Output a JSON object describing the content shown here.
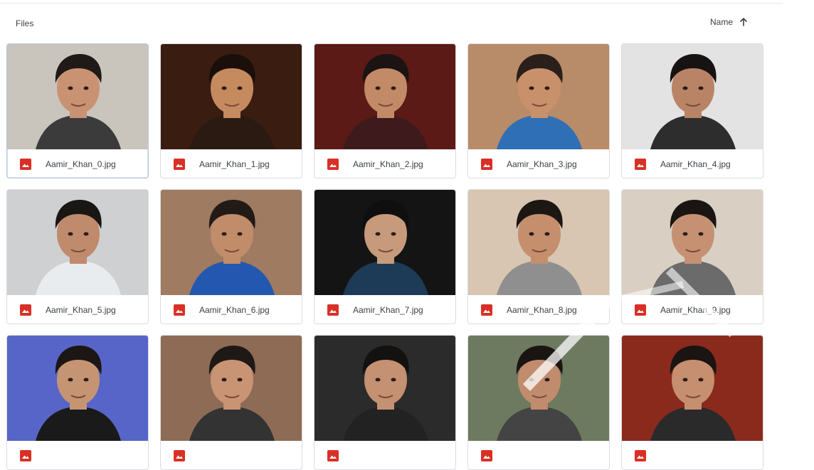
{
  "header": {
    "section_title": "Files",
    "sort_label": "Name",
    "sort_icon": "arrow-up-icon"
  },
  "files": [
    {
      "name": "Aamir_Khan_0.jpg",
      "bg": "#c9c4bc",
      "skin": "#c99273",
      "hair": "#1f1a17",
      "shirt": "#3b3b3b"
    },
    {
      "name": "Aamir_Khan_1.jpg",
      "bg": "#3a1c10",
      "skin": "#c58a5e",
      "hair": "#1a0f0a",
      "shirt": "#2a1a12"
    },
    {
      "name": "Aamir_Khan_2.jpg",
      "bg": "#5b1a16",
      "skin": "#c28a66",
      "hair": "#1b1412",
      "shirt": "#3f1a1c"
    },
    {
      "name": "Aamir_Khan_3.jpg",
      "bg": "#b88b69",
      "skin": "#c8906b",
      "hair": "#2a1f1a",
      "shirt": "#2f6fb5"
    },
    {
      "name": "Aamir_Khan_4.jpg",
      "bg": "#e3e3e3",
      "skin": "#b98466",
      "hair": "#161312",
      "shirt": "#2d2d2d"
    },
    {
      "name": "Aamir_Khan_5.jpg",
      "bg": "#cfd0d2",
      "skin": "#c08a6c",
      "hair": "#1a1614",
      "shirt": "#e9ecef"
    },
    {
      "name": "Aamir_Khan_6.jpg",
      "bg": "#9e7b61",
      "skin": "#c18c69",
      "hair": "#221a16",
      "shirt": "#2457b0"
    },
    {
      "name": "Aamir_Khan_7.jpg",
      "bg": "#141414",
      "skin": "#c69a7b",
      "hair": "#0f0f0f",
      "shirt": "#1d3b56"
    },
    {
      "name": "Aamir_Khan_8.jpg",
      "bg": "#d8c6b2",
      "skin": "#c58e6d",
      "hair": "#1d1714",
      "shirt": "#8f8f8f"
    },
    {
      "name": "Aamir_Khan_9.jpg",
      "bg": "#d9d0c3",
      "skin": "#c69173",
      "hair": "#1a1513",
      "shirt": "#6b6b6b"
    },
    {
      "name": "",
      "bg": "#5865c8",
      "skin": "#c59473",
      "hair": "#1c1614",
      "shirt": "#1a1a1a"
    },
    {
      "name": "",
      "bg": "#8e6b55",
      "skin": "#c89473",
      "hair": "#1f1916",
      "shirt": "#333333"
    },
    {
      "name": "",
      "bg": "#2b2b2b",
      "skin": "#c49172",
      "hair": "#141111",
      "shirt": "#222222"
    },
    {
      "name": "",
      "bg": "#6d7a5f",
      "skin": "#c08c6d",
      "hair": "#1a1513",
      "shirt": "#444444"
    },
    {
      "name": "",
      "bg": "#8a2a1c",
      "skin": "#c58f70",
      "hair": "#1a1412",
      "shirt": "#2a2a2a"
    }
  ],
  "colors": {
    "file_type_icon": "#d93025",
    "selected_border": "#b7c7dd",
    "text": "#3c4043"
  }
}
